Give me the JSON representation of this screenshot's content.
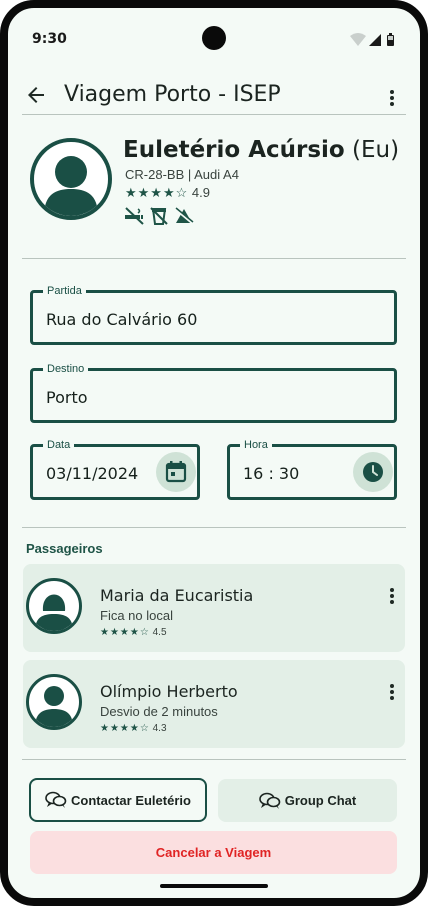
{
  "status_bar": {
    "time": "9:30"
  },
  "header": {
    "title": "Viagem Porto - ISEP"
  },
  "driver": {
    "name": "Euletério Acúrsio",
    "suffix": "(Eu)",
    "car": "CR-28-BB | Audi A4",
    "stars": "★★★★☆",
    "rating": "4.9",
    "preference_icons": [
      "no-smoking-icon",
      "no-drinks-icon",
      "no-food-icon"
    ]
  },
  "form": {
    "partida": {
      "label": "Partida",
      "value": "Rua do Calvário 60"
    },
    "destino": {
      "label": "Destino",
      "value": "Porto"
    },
    "data": {
      "label": "Data",
      "value": "03/11/2024"
    },
    "hora": {
      "label": "Hora",
      "value": "16 : 30"
    }
  },
  "passengers": {
    "title": "Passageiros",
    "items": [
      {
        "name": "Maria da Eucaristia",
        "status": "Fica no local",
        "stars": "★★★★☆",
        "rating": "4.5"
      },
      {
        "name": "Olímpio Herberto",
        "status": "Desvio de 2 minutos",
        "stars": "★★★★☆",
        "rating": "4.3"
      }
    ]
  },
  "actions": {
    "contact_label": "Contactar Euletério",
    "group_chat_label": "Group Chat",
    "cancel_label": "Cancelar a Viagem"
  },
  "colors": {
    "primary": "#1a4f45",
    "background": "#f4faf6",
    "card": "#e3efe7",
    "danger": "#e02424",
    "danger_bg": "#fbdfe0"
  }
}
